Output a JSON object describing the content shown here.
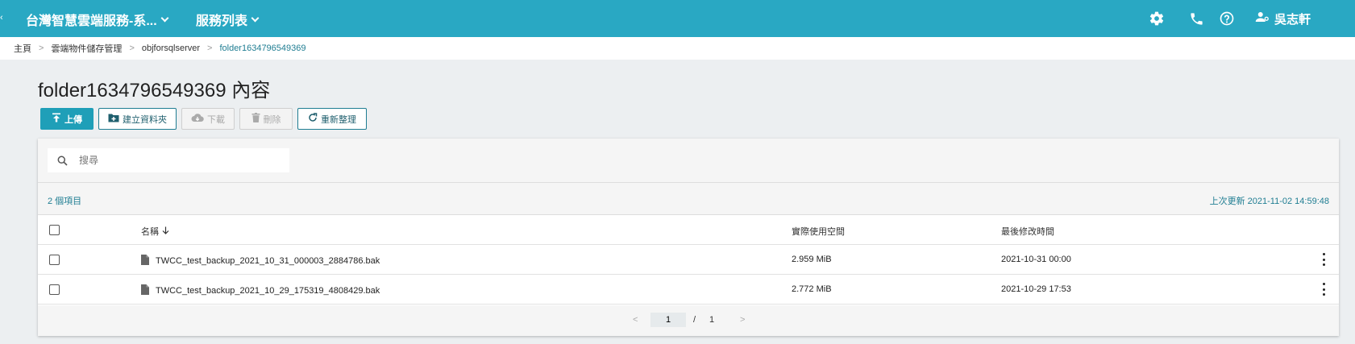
{
  "topbar": {
    "brand": "台灣智慧雲端服務-系...",
    "services": "服務列表",
    "user": "吳志軒",
    "icons": [
      "gear-icon",
      "phone-icon",
      "help-icon",
      "user-icon"
    ],
    "color": "#29a8c3"
  },
  "breadcrumb": [
    {
      "label": "主頁"
    },
    {
      "label": "雲端物件儲存管理"
    },
    {
      "label": "objforsqlserver"
    },
    {
      "label": "folder1634796549369"
    }
  ],
  "page": {
    "title": "folder1634796549369 內容"
  },
  "toolbar": {
    "upload": "上傳",
    "create_folder": "建立資料夾",
    "download": "下載",
    "delete": "刪除",
    "refresh": "重新整理"
  },
  "search": {
    "placeholder": "搜尋",
    "value": ""
  },
  "meta": {
    "count": "2 個項目",
    "updated": "上次更新 2021-11-02 14:59:48"
  },
  "table": {
    "headers": {
      "name": "名稱",
      "size": "實際使用空間",
      "modified": "最後修改時間"
    },
    "rows": [
      {
        "name": "TWCC_test_backup_2021_10_31_000003_2884786.bak",
        "size": "2.959 MiB",
        "modified": "2021-10-31 00:00"
      },
      {
        "name": "TWCC_test_backup_2021_10_29_175319_4808429.bak",
        "size": "2.772 MiB",
        "modified": "2021-10-29 17:53"
      }
    ]
  },
  "pagination": {
    "current": "1",
    "separator": "/",
    "total": "1"
  }
}
